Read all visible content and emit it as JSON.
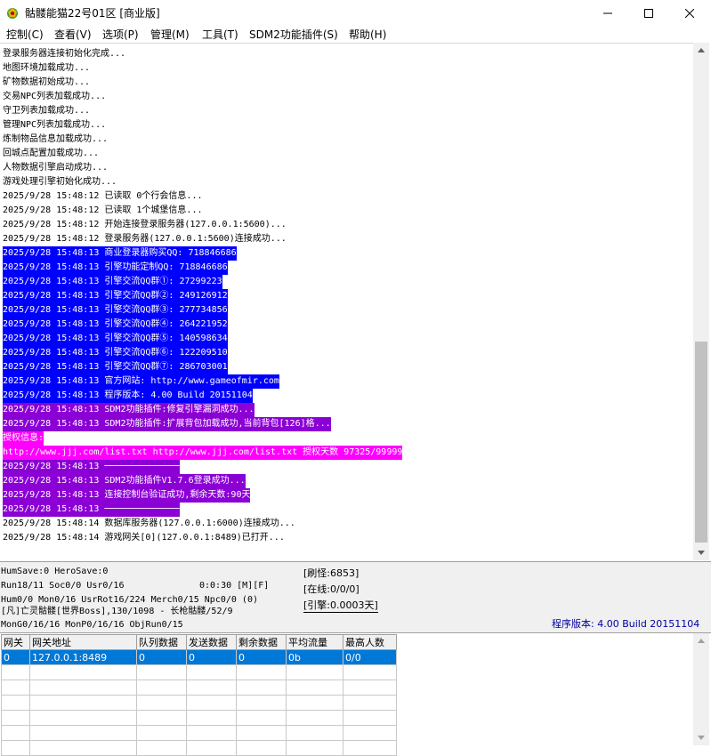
{
  "window": {
    "title": "骷髅能猫22号01区 [商业版]"
  },
  "menu": {
    "items": [
      {
        "label": "控制(C)"
      },
      {
        "label": "查看(V)"
      },
      {
        "label": "选项(P)"
      },
      {
        "label": "管理(M)"
      },
      {
        "label": "工具(T)"
      },
      {
        "label": "SDM2功能插件(S)"
      },
      {
        "label": "帮助(H)"
      }
    ]
  },
  "log": {
    "lines": [
      {
        "text": "登录服务器连接初始化完成...",
        "bg": "",
        "fg": "#000000"
      },
      {
        "text": "地图环境加载成功...",
        "bg": "",
        "fg": "#000000"
      },
      {
        "text": "矿物数据初始成功...",
        "bg": "",
        "fg": "#000000"
      },
      {
        "text": "交易NPC列表加载成功...",
        "bg": "",
        "fg": "#000000"
      },
      {
        "text": "守卫列表加载成功...",
        "bg": "",
        "fg": "#000000"
      },
      {
        "text": "管理NPC列表加载成功...",
        "bg": "",
        "fg": "#000000"
      },
      {
        "text": "炼制物品信息加载成功...",
        "bg": "",
        "fg": "#000000"
      },
      {
        "text": "回城点配置加载成功...",
        "bg": "",
        "fg": "#000000"
      },
      {
        "text": "人物数据引擎启动成功...",
        "bg": "",
        "fg": "#000000"
      },
      {
        "text": "游戏处理引擎初始化成功...",
        "bg": "",
        "fg": "#000000"
      },
      {
        "text": "2025/9/28 15:48:12 已读取 0个行会信息...",
        "bg": "",
        "fg": "#000000"
      },
      {
        "text": "2025/9/28 15:48:12 已读取 1个城堡信息...",
        "bg": "",
        "fg": "#000000"
      },
      {
        "text": "2025/9/28 15:48:12 开始连接登录服务器(127.0.0.1:5600)...",
        "bg": "",
        "fg": "#000000"
      },
      {
        "text": "2025/9/28 15:48:12 登录服务器(127.0.0.1:5600)连接成功...",
        "bg": "",
        "fg": "#000000"
      },
      {
        "text": "2025/9/28 15:48:13 商业登录器购买QQ: 718846686",
        "bg": "#0000ff",
        "fg": "#ffffff"
      },
      {
        "text": "2025/9/28 15:48:13 引擎功能定制QQ: 718846686",
        "bg": "#0000ff",
        "fg": "#ffffff"
      },
      {
        "text": "2025/9/28 15:48:13 引擎交流QQ群①: 27299223",
        "bg": "#0000ff",
        "fg": "#ffffff"
      },
      {
        "text": "2025/9/28 15:48:13 引擎交流QQ群②: 249126912",
        "bg": "#0000ff",
        "fg": "#ffffff"
      },
      {
        "text": "2025/9/28 15:48:13 引擎交流QQ群③: 277734856",
        "bg": "#0000ff",
        "fg": "#ffffff"
      },
      {
        "text": "2025/9/28 15:48:13 引擎交流QQ群④: 264221952",
        "bg": "#0000ff",
        "fg": "#ffffff"
      },
      {
        "text": "2025/9/28 15:48:13 引擎交流QQ群⑤: 140598634",
        "bg": "#0000ff",
        "fg": "#ffffff"
      },
      {
        "text": "2025/9/28 15:48:13 引擎交流QQ群⑥: 122209510",
        "bg": "#0000ff",
        "fg": "#ffffff"
      },
      {
        "text": "2025/9/28 15:48:13 引擎交流QQ群⑦: 286703001",
        "bg": "#0000ff",
        "fg": "#ffffff"
      },
      {
        "text": "2025/9/28 15:48:13 官方网站: http://www.gameofmir.com",
        "bg": "#0000ff",
        "fg": "#ffffff"
      },
      {
        "text": "2025/9/28 15:48:13 程序版本: 4.00 Build 20151104",
        "bg": "#0000ff",
        "fg": "#ffffff"
      },
      {
        "text": "2025/9/28 15:48:13 SDM2功能插件:修复引擎漏洞成功...",
        "bg": "#8b00d4",
        "fg": "#ffffff"
      },
      {
        "text": "2025/9/28 15:48:13 SDM2功能插件:扩展背包加载成功,当前背包[126]格...",
        "bg": "#8b00d4",
        "fg": "#ffffff"
      },
      {
        "text": "授权信息:",
        "bg": "#ff00ff",
        "fg": "#ffffff"
      },
      {
        "text": "http://www.jjj.com/list.txt http://www.jjj.com/list.txt 授权天数 97325/99999",
        "bg": "#ff00ff",
        "fg": "#ffffff"
      },
      {
        "text": "2025/9/28 15:48:13 ──────────────",
        "bg": "#8b00d4",
        "fg": "#ffffff"
      },
      {
        "text": "2025/9/28 15:48:13 SDM2功能插件V1.7.6登录成功...",
        "bg": "#8b00d4",
        "fg": "#ffffff"
      },
      {
        "text": "2025/9/28 15:48:13 连接控制台验证成功,剩余天数:90天",
        "bg": "#8b00d4",
        "fg": "#ffffff"
      },
      {
        "text": "2025/9/28 15:48:13 ──────────────",
        "bg": "#8b00d4",
        "fg": "#ffffff"
      },
      {
        "text": "2025/9/28 15:48:14 数据库服务器(127.0.0.1:6000)连接成功...",
        "bg": "",
        "fg": "#000000"
      },
      {
        "text": "2025/9/28 15:48:14 游戏网关[0](127.0.0.1:8489)已打开...",
        "bg": "",
        "fg": "#000000"
      }
    ]
  },
  "status": {
    "line1": "HumSave:0 HeroSave:0",
    "line2_left": "Run18/11 Soc0/0 Usr0/16",
    "line2_right": "0:0:30 [M][F]",
    "line3": "Hum0/0 Mon0/16 UsrRot16/224 Merch0/15 Npc0/0 (0)",
    "line4": "[凡]亡灵骷髅[世界Boss],130/1098 - 长枪骷髅/52/9",
    "line5": "MonG0/16/16 MonP0/16/16 ObjRun0/15",
    "refresh": "[刷怪:6853]",
    "online": "[在线:0/0/0]",
    "engine": "[引擎:0.0003天]",
    "version": "程序版本: 4.00 Build 20151104"
  },
  "gateway_table": {
    "columns": [
      "网关",
      "网关地址",
      "队列数据",
      "发送数据",
      "剩余数据",
      "平均流量",
      "最高人数"
    ],
    "rows": [
      [
        "0",
        "127.0.0.1:8489",
        "0",
        "0",
        "0",
        "0b",
        "0/0"
      ]
    ]
  },
  "colors": {
    "blue_highlight": "#0000ff",
    "purple_highlight": "#8b00d4",
    "magenta_highlight": "#ff00ff",
    "selection": "#0078d7",
    "version_text": "#0000a0"
  }
}
